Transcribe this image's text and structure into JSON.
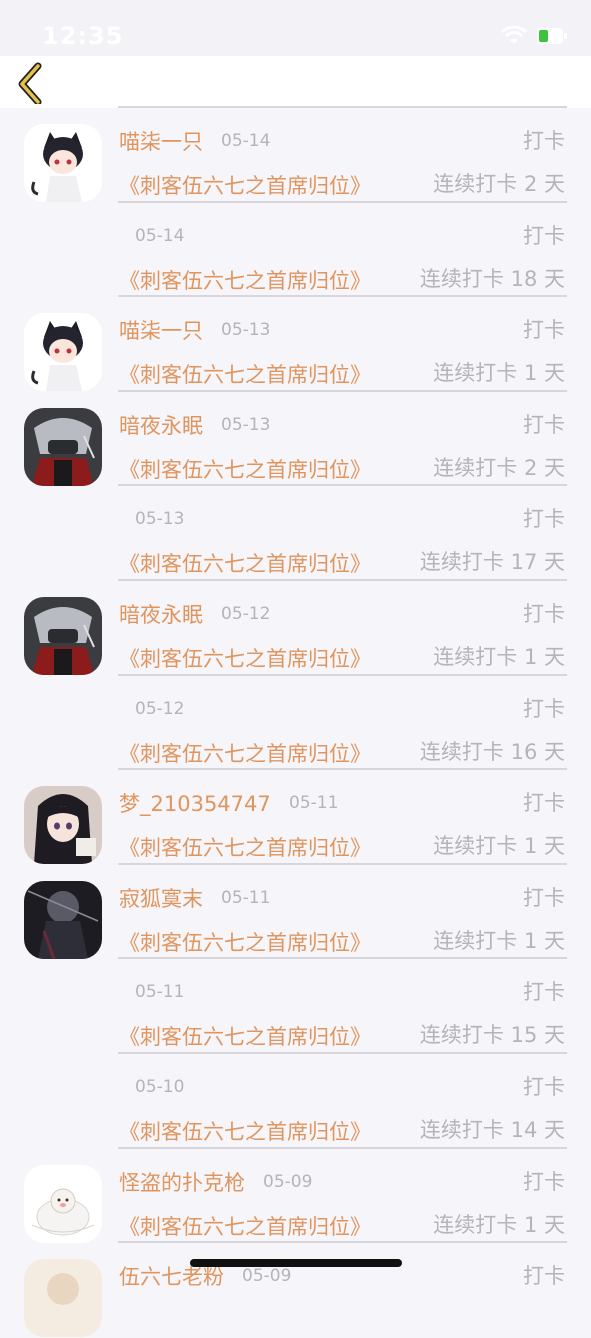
{
  "status": {
    "time": "12:35"
  },
  "nav": {
    "back_icon": "chevron-left-icon",
    "accent": "#e0b53a"
  },
  "colors": {
    "accent_text": "#e0955e",
    "muted_text": "#b5b4b9",
    "background": "#f6f5f9"
  },
  "entries": [
    {
      "user": "喵柒一只",
      "date": "05-14",
      "action": "打卡",
      "book": "《刺客伍六七之首席归位》",
      "streak": "连续打卡 2 天",
      "avatar": "cat-ears-boy"
    },
    {
      "user": "",
      "date": "05-14",
      "action": "打卡",
      "book": "《刺客伍六七之首席归位》",
      "streak": "连续打卡 18 天",
      "avatar": ""
    },
    {
      "user": "喵柒一只",
      "date": "05-13",
      "action": "打卡",
      "book": "《刺客伍六七之首席归位》",
      "streak": "连续打卡 1 天",
      "avatar": "cat-ears-boy"
    },
    {
      "user": "暗夜永眠",
      "date": "05-13",
      "action": "打卡",
      "book": "《刺客伍六七之首席归位》",
      "streak": "连续打卡 2 天",
      "avatar": "masked-warrior"
    },
    {
      "user": "",
      "date": "05-13",
      "action": "打卡",
      "book": "《刺客伍六七之首席归位》",
      "streak": "连续打卡 17 天",
      "avatar": ""
    },
    {
      "user": "暗夜永眠",
      "date": "05-12",
      "action": "打卡",
      "book": "《刺客伍六七之首席归位》",
      "streak": "连续打卡 1 天",
      "avatar": "masked-warrior"
    },
    {
      "user": "",
      "date": "05-12",
      "action": "打卡",
      "book": "《刺客伍六七之首席归位》",
      "streak": "连续打卡 16 天",
      "avatar": ""
    },
    {
      "user": "梦_210354747",
      "date": "05-11",
      "action": "打卡",
      "book": "《刺客伍六七之首席归位》",
      "streak": "连续打卡 1 天",
      "avatar": "dark-hair-girl"
    },
    {
      "user": "寂狐寞末",
      "date": "05-11",
      "action": "打卡",
      "book": "《刺客伍六七之首席归位》",
      "streak": "连续打卡 1 天",
      "avatar": "dark-figure"
    },
    {
      "user": "",
      "date": "05-11",
      "action": "打卡",
      "book": "《刺客伍六七之首席归位》",
      "streak": "连续打卡 15 天",
      "avatar": ""
    },
    {
      "user": "",
      "date": "05-10",
      "action": "打卡",
      "book": "《刺客伍六七之首席归位》",
      "streak": "连续打卡 14 天",
      "avatar": ""
    },
    {
      "user": "怪盗的扑克枪",
      "date": "05-09",
      "action": "打卡",
      "book": "《刺客伍六七之首席归位》",
      "streak": "连续打卡 1 天",
      "avatar": "white-bear"
    },
    {
      "user": "伍六七老粉",
      "date": "05-09",
      "action": "打卡",
      "book": "",
      "streak": "",
      "avatar": "cream-avatar"
    }
  ]
}
